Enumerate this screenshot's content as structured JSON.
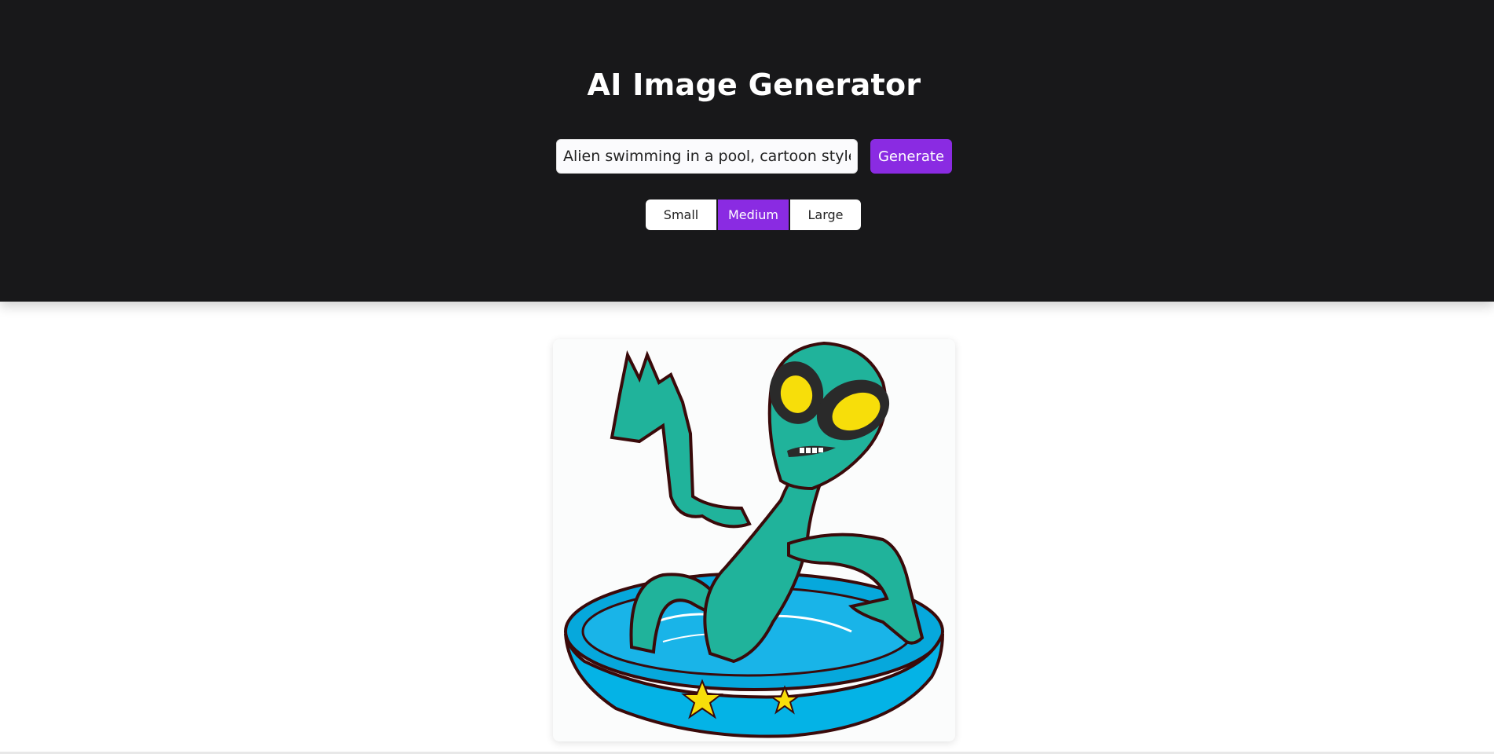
{
  "header": {
    "title": "AI Image Generator"
  },
  "prompt": {
    "value": "Alien swimming in a pool, cartoon style",
    "placeholder": ""
  },
  "actions": {
    "generate_label": "Generate"
  },
  "size_options": [
    {
      "label": "Small",
      "selected": false
    },
    {
      "label": "Medium",
      "selected": true
    },
    {
      "label": "Large",
      "selected": false
    }
  ],
  "result": {
    "image_description_icon": "alien-in-pool-image"
  },
  "colors": {
    "header_bg": "#18181a",
    "accent": "#8a2be2",
    "page_bg": "#ffffff"
  }
}
